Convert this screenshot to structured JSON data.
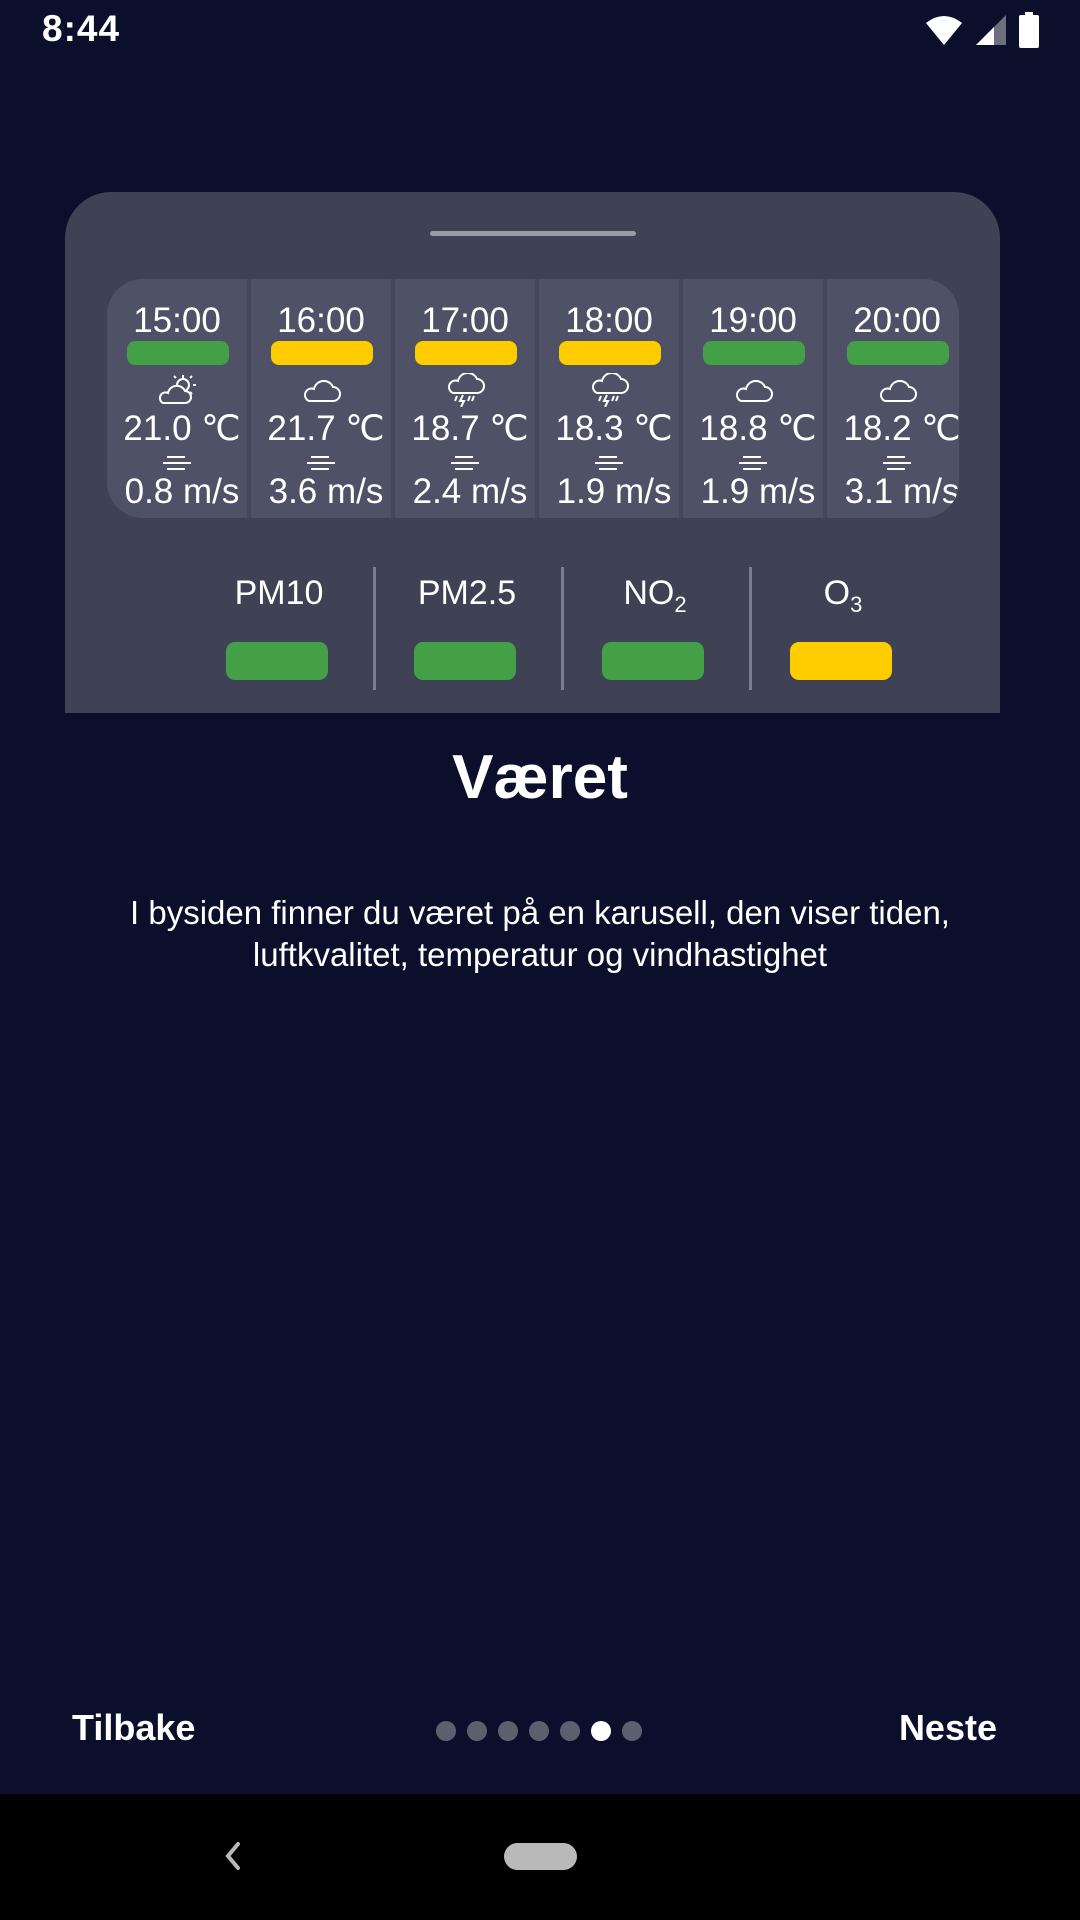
{
  "status_bar": {
    "time": "8:44",
    "icons": [
      "wifi-icon",
      "cellular-signal-icon",
      "battery-icon"
    ]
  },
  "colors": {
    "background": "#0b0f2b",
    "card": "#3f4254",
    "good": "#43a047",
    "moderate": "#ffcc00"
  },
  "forecast": [
    {
      "time": "15:00",
      "aq": "good",
      "icon": "partly-sunny-icon",
      "temp": "21.0 ℃",
      "wind": "0.8  m/s"
    },
    {
      "time": "16:00",
      "aq": "moderate",
      "icon": "cloud-icon",
      "temp": "21.7 ℃",
      "wind": "3.6  m/s"
    },
    {
      "time": "17:00",
      "aq": "moderate",
      "icon": "thunderstorm-icon",
      "temp": "18.7 ℃",
      "wind": "2.4  m/s"
    },
    {
      "time": "18:00",
      "aq": "moderate",
      "icon": "thunderstorm-icon",
      "temp": "18.3 ℃",
      "wind": "1.9  m/s"
    },
    {
      "time": "19:00",
      "aq": "good",
      "icon": "cloud-icon",
      "temp": "18.8 ℃",
      "wind": "1.9  m/s"
    },
    {
      "time": "20:00",
      "aq": "good",
      "icon": "cloud-icon",
      "temp": "18.2 ℃",
      "wind": "3.1  m/s"
    }
  ],
  "pollutants": [
    {
      "label": "PM10",
      "sub": "",
      "level": "good"
    },
    {
      "label": "PM2.5",
      "sub": "",
      "level": "good"
    },
    {
      "label": "NO",
      "sub": "2",
      "level": "good"
    },
    {
      "label": "O",
      "sub": "3",
      "level": "moderate"
    }
  ],
  "title": "Været",
  "description": "I bysiden finner du været på en karusell, den viser tiden, luftkvalitet, temperatur og vindhastighet",
  "navigation": {
    "back_label": "Tilbake",
    "next_label": "Neste",
    "page_count": 7,
    "current_page": 6
  }
}
